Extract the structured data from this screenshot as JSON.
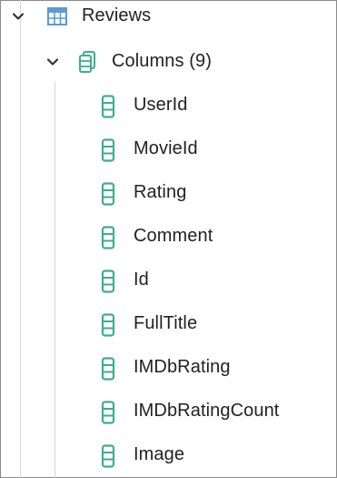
{
  "table": {
    "label": "Reviews",
    "icon": "table-icon",
    "expanded": true
  },
  "columns_group": {
    "label": "Columns (9)",
    "icon": "columns-icon",
    "expanded": true
  },
  "columns": [
    {
      "label": "UserId",
      "icon": "column-icon"
    },
    {
      "label": "MovieId",
      "icon": "column-icon"
    },
    {
      "label": "Rating",
      "icon": "column-icon"
    },
    {
      "label": "Comment",
      "icon": "column-icon"
    },
    {
      "label": "Id",
      "icon": "column-icon"
    },
    {
      "label": "FullTitle",
      "icon": "column-icon"
    },
    {
      "label": "IMDbRating",
      "icon": "column-icon"
    },
    {
      "label": "IMDbRatingCount",
      "icon": "column-icon"
    },
    {
      "label": "Image",
      "icon": "column-icon"
    }
  ],
  "colors": {
    "table_icon": "#5b9bd5",
    "column_icon": "#3cae8c",
    "chevron": "#333333"
  }
}
